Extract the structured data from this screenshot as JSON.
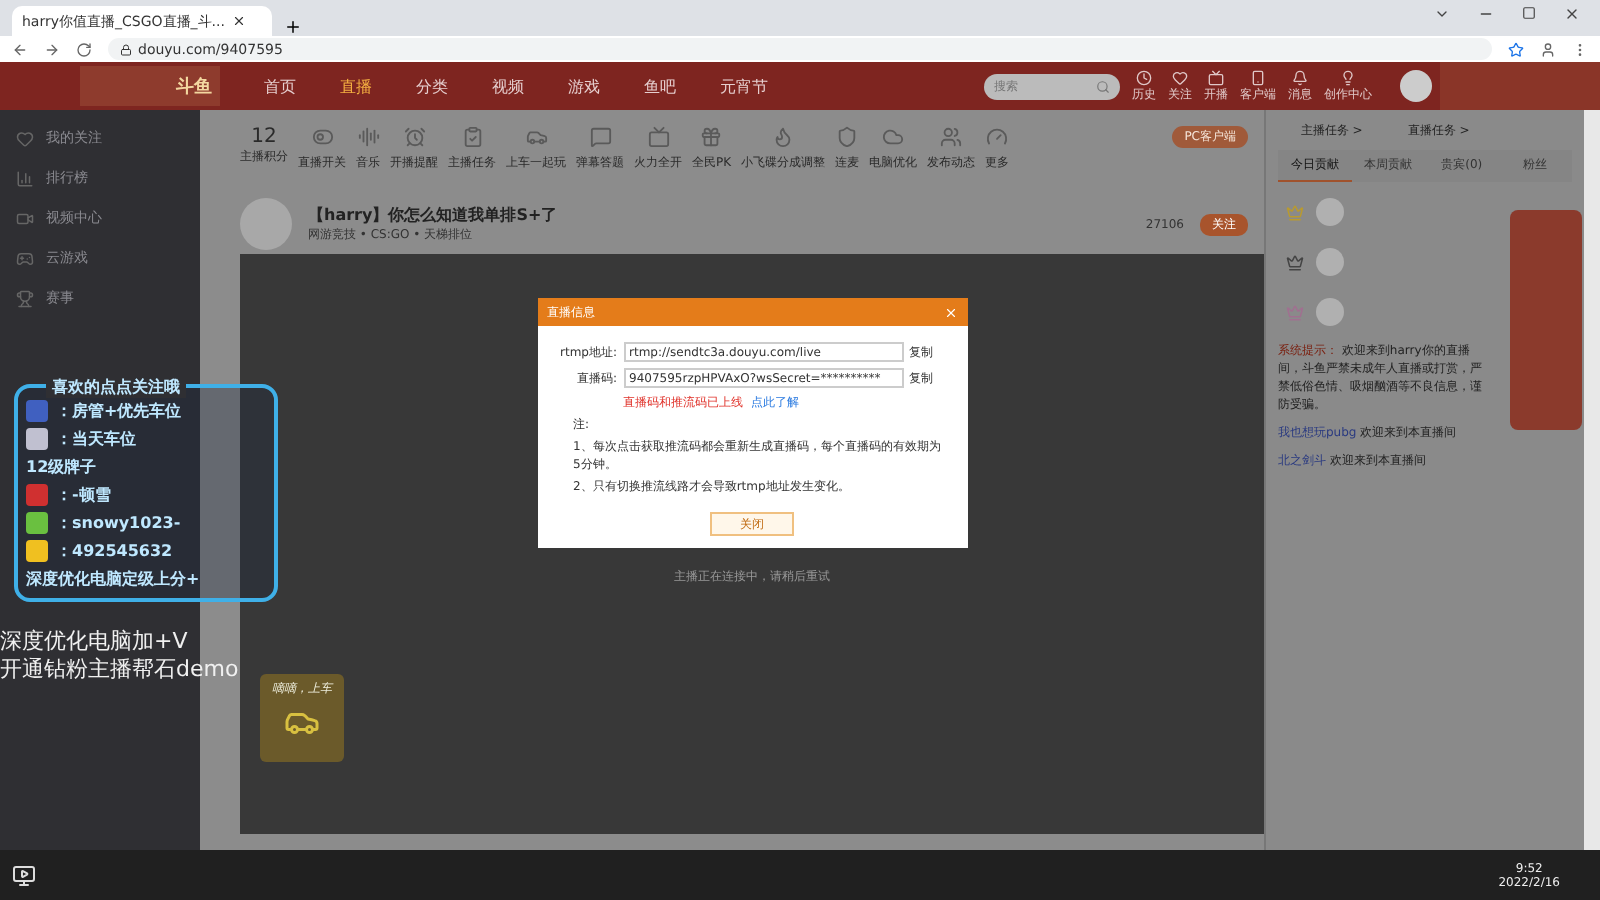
{
  "browser": {
    "tab_title": "harry你值直播_CSGO直播_斗...",
    "url": "douyu.com/9407595"
  },
  "header": {
    "logo": "斗鱼",
    "nav": [
      {
        "label": "首页",
        "selected": false
      },
      {
        "label": "直播",
        "selected": true
      },
      {
        "label": "分类",
        "selected": false
      },
      {
        "label": "视频",
        "selected": false
      },
      {
        "label": "游戏",
        "selected": false
      },
      {
        "label": "鱼吧",
        "selected": false
      },
      {
        "label": "元宵节",
        "selected": false
      }
    ],
    "search": {
      "placeholder": "搜索"
    },
    "actions": [
      "历史",
      "关注",
      "开播",
      "客户端",
      "消息",
      "创作中心"
    ]
  },
  "sidebar": {
    "items": [
      "我的关注",
      "排行榜",
      "视频中心",
      "云游戏",
      "赛事"
    ]
  },
  "toolbar": {
    "score": "12",
    "score_label": "主播积分",
    "tools": [
      "直播开关",
      "音乐",
      "开播提醒",
      "主播任务",
      "上车一起玩",
      "弹幕答题",
      "火力全开",
      "全民PK",
      "小飞碟分成调整",
      "连麦",
      "电脑优化",
      "发布动态",
      "更多"
    ],
    "client_button": "PC客户端"
  },
  "room": {
    "title": "【harry】你怎么知道我单排S+了",
    "category": "网游竞技 • CS:GO • 天梯排位",
    "fans": "27106",
    "follow": "关注"
  },
  "dialog": {
    "title": "直播信息",
    "fields": [
      {
        "label": "rtmp地址:",
        "value": "rtmp://sendtc3a.douyu.com/live",
        "copy": "复制"
      },
      {
        "label": "直播码:",
        "value": "9407595rzpHPVAxO?wsSecret=**********",
        "copy": "复制"
      }
    ],
    "warning": "直播码和推流码已上线",
    "link": "点此了解",
    "notes": [
      "注:",
      "1、每次点击获取推流码都会重新生成直播码，每个直播码的有效期为5分钟。",
      "2、只有切换推流线路才会导致rtmp地址发生变化。"
    ],
    "close": "关闭"
  },
  "video_notice": "主播正在连接中，请稍后重试",
  "overlay": {
    "heading": "喜欢的点点关注哦",
    "lines": [
      {
        "kind": "badge",
        "text": "：房管+优先车位"
      },
      {
        "kind": "car",
        "text": "：当天车位"
      },
      {
        "kind": "plain",
        "text": "12级牌子"
      },
      {
        "kind": "weibo",
        "text": "：-顿雪"
      },
      {
        "kind": "wechat",
        "text": "：snowy1023-"
      },
      {
        "kind": "qq",
        "text": "：492545632"
      },
      {
        "kind": "plain",
        "text": "深度优化电脑定级上分+"
      }
    ],
    "caption": [
      "深度优化电脑加+V",
      "开通钻粉主播帮石demo"
    ]
  },
  "promo": {
    "title": "嘀嘀，上车"
  },
  "right_panel": {
    "links": [
      "主播任务 >",
      "直播任务 >"
    ],
    "tabs": [
      {
        "label": "今日贡献",
        "selected": true
      },
      {
        "label": "本周贡献",
        "selected": false
      },
      {
        "label": "贵宾(0)",
        "selected": false
      },
      {
        "label": "粉丝",
        "selected": false
      }
    ],
    "messages": [
      {
        "kind": "system",
        "user": "系统提示：",
        "text": "欢迎来到harry你的直播间，斗鱼严禁未成年人直播或打赏，严禁低俗色情、吸烟酗酒等不良信息，谨防受骗。"
      },
      {
        "kind": "welcome",
        "user": "我也想玩pubg",
        "text": "欢迎来到本直播间"
      },
      {
        "kind": "welcome",
        "user": "北之剑斗",
        "text": "欢迎来到本直播间"
      }
    ]
  },
  "taskbar": {
    "time": "9:52",
    "date": "2022/2/16"
  }
}
